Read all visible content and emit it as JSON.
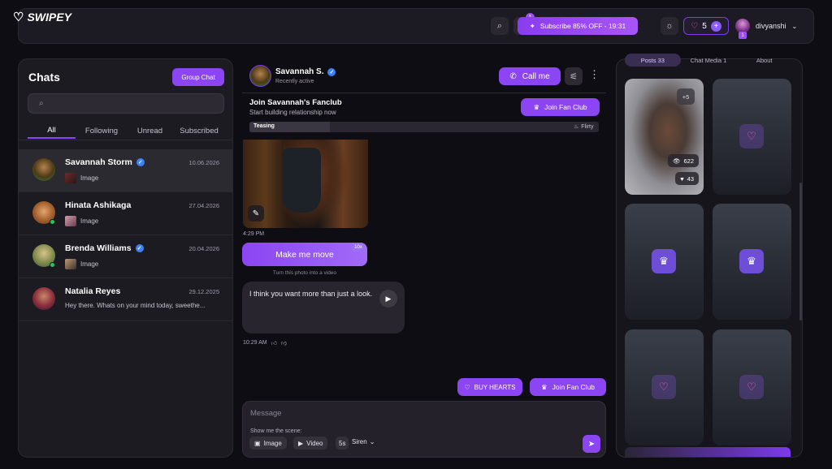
{
  "app": {
    "name": "SWIPEY"
  },
  "topbar": {
    "notification_count": "1",
    "subscribe_label": "Subscribe 85% OFF - 19:31",
    "hearts_count": "5",
    "user_name": "divyanshi",
    "user_badge": "1"
  },
  "chats": {
    "title": "Chats",
    "group_chat_label": "Group Chat",
    "search_placeholder": "",
    "tabs": [
      "All",
      "Following",
      "Unread",
      "Subscribed"
    ],
    "items": [
      {
        "name": "Savannah Storm",
        "verified": true,
        "date": "10.06.2026",
        "preview": "Image",
        "online": false
      },
      {
        "name": "Hinata Ashikaga",
        "verified": false,
        "date": "27.04.2026",
        "preview": "Image",
        "online": true
      },
      {
        "name": "Brenda Williams",
        "verified": true,
        "date": "20.04.2026",
        "preview": "Image",
        "online": true
      },
      {
        "name": "Natalia Reyes",
        "verified": false,
        "date": "29.12.2025",
        "preview": "Hey there. Whats on your mind today, sweethe...",
        "online": false
      }
    ]
  },
  "conversation": {
    "name": "Savannah S.",
    "status": "Recently active",
    "call_label": "Call me",
    "fanclub_title": "Join Savannah's Fanclub",
    "fanclub_sub": "Start building relationship now",
    "join_label": "Join Fan Club",
    "relationship": {
      "left_label": "Teasing",
      "right_label": "Flirty",
      "progress": 0.23
    },
    "photo_time": "4:29 PM",
    "make_move_label": "Make me move",
    "make_move_cost": "10x",
    "make_move_caption": "Turn this photo into a video",
    "message_text": "I think you want more than just a look.",
    "message_time": "10:29 AM",
    "buy_hearts_label": "BUY HEARTS",
    "join_bottom_label": "Join Fan Club",
    "composer_placeholder": "Message",
    "scene_label": "Show me the scene:",
    "chip_image": "Image",
    "chip_video": "Video",
    "chip_5s": "5s",
    "chip_mode": "Siren"
  },
  "gallery": {
    "tabs": [
      "Posts 33",
      "Chat Media 1",
      "About"
    ],
    "first_tile": {
      "more": "+5",
      "views": "622",
      "likes": "43"
    }
  },
  "colors": {
    "accent": "#8b45f2",
    "background": "#0f0d14",
    "panel": "#1d1b22"
  }
}
